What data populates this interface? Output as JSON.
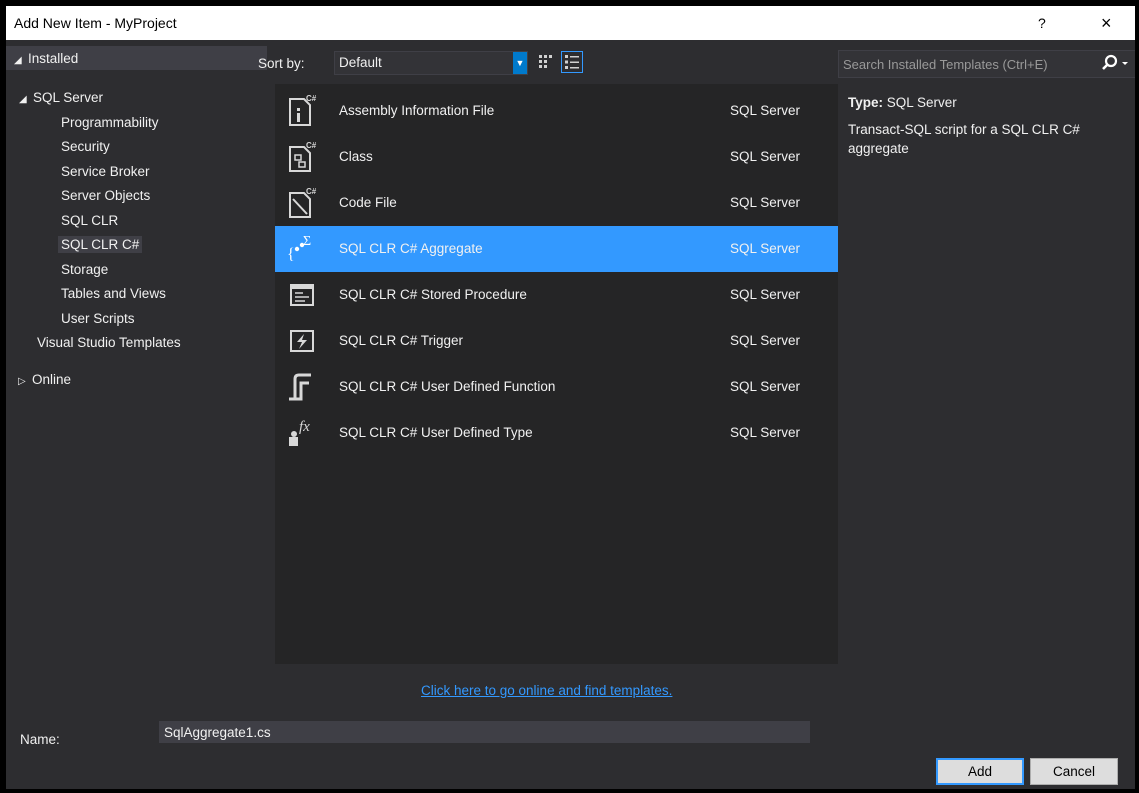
{
  "window": {
    "title": "Add New Item - MyProject",
    "help": "?",
    "close": "×"
  },
  "tree": {
    "installed": "Installed",
    "sql_server": "SQL Server",
    "children": [
      "Programmability",
      "Security",
      "Service Broker",
      "Server Objects",
      "SQL CLR",
      "SQL CLR C#",
      "Storage",
      "Tables and Views",
      "User Scripts"
    ],
    "selected_child": "SQL CLR C#",
    "vs_templates": "Visual Studio Templates",
    "online": "Online"
  },
  "toolbar": {
    "sort_label": "Sort by:",
    "sort_value": "Default"
  },
  "search": {
    "placeholder": "Search Installed Templates (Ctrl+E)"
  },
  "templates": [
    {
      "name": "Assembly Information File",
      "category": "SQL Server",
      "icon": "assembly-info-file-icon"
    },
    {
      "name": "Class",
      "category": "SQL Server",
      "icon": "class-file-icon"
    },
    {
      "name": "Code File",
      "category": "SQL Server",
      "icon": "code-file-icon"
    },
    {
      "name": "SQL CLR C# Aggregate",
      "category": "SQL Server",
      "icon": "aggregate-icon",
      "selected": true
    },
    {
      "name": "SQL CLR C# Stored Procedure",
      "category": "SQL Server",
      "icon": "stored-procedure-icon"
    },
    {
      "name": "SQL CLR C# Trigger",
      "category": "SQL Server",
      "icon": "trigger-icon"
    },
    {
      "name": "SQL CLR C# User Defined Function",
      "category": "SQL Server",
      "icon": "user-defined-function-icon"
    },
    {
      "name": "SQL CLR C# User Defined Type",
      "category": "SQL Server",
      "icon": "user-defined-type-icon"
    }
  ],
  "details": {
    "type_label": "Type:",
    "type_value": "SQL Server",
    "description": "Transact-SQL script for a SQL CLR C# aggregate"
  },
  "online_link": "Click here to go online and find templates.",
  "name_field": {
    "label": "Name:",
    "value": "SqlAggregate1.cs"
  },
  "buttons": {
    "add": "Add",
    "cancel": "Cancel"
  },
  "colors": {
    "accent": "#3399ff",
    "background": "#2d2d30",
    "list_background": "#252526"
  }
}
